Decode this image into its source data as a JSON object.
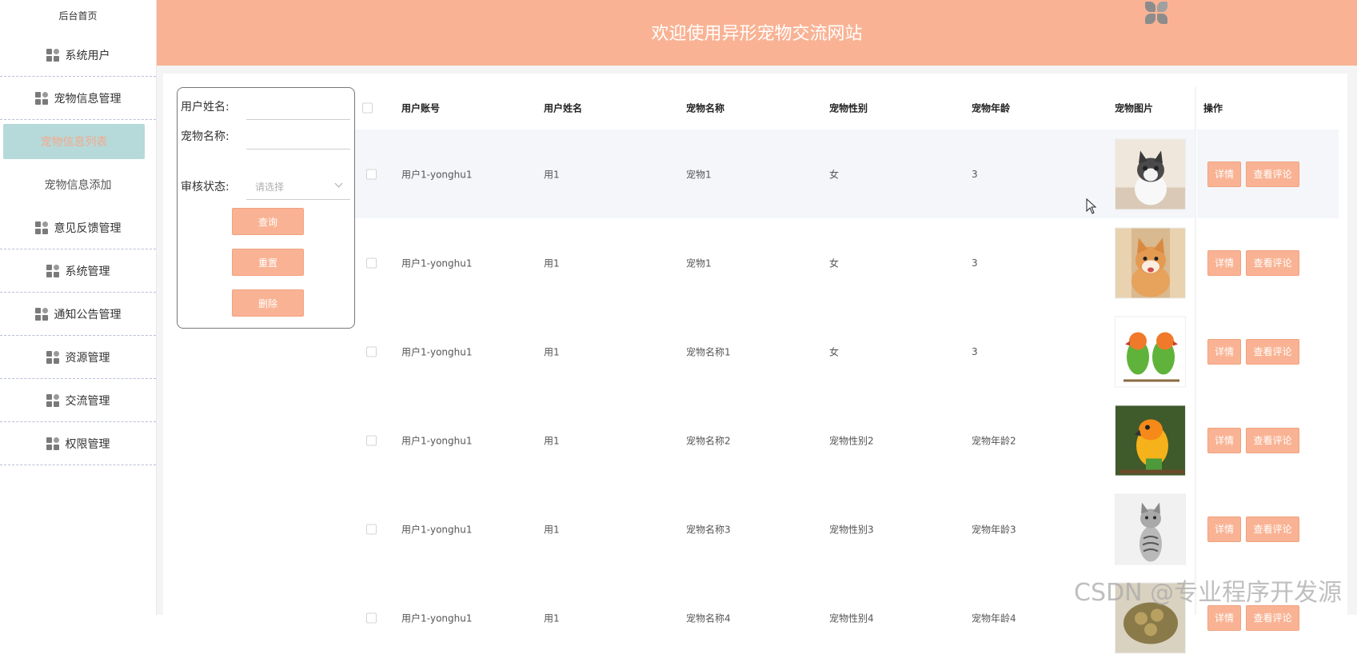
{
  "sidebar": {
    "home": "后台首页",
    "menus": [
      {
        "label": "系统用户"
      },
      {
        "label": "宠物信息管理",
        "subs": [
          {
            "label": "宠物信息列表",
            "active": true
          },
          {
            "label": "宠物信息添加"
          }
        ]
      },
      {
        "label": "意见反馈管理"
      },
      {
        "label": "系统管理"
      },
      {
        "label": "通知公告管理"
      },
      {
        "label": "资源管理"
      },
      {
        "label": "交流管理"
      },
      {
        "label": "权限管理"
      }
    ]
  },
  "header": {
    "title": "欢迎使用异形宠物交流网站",
    "logo_icon": "app-logo-icon"
  },
  "search": {
    "user_name_label": "用户姓名:",
    "pet_name_label": "宠物名称:",
    "status_label": "审核状态:",
    "status_placeholder": "请选择",
    "query_button": "查询",
    "reset_button": "重置",
    "delete_button": "删除"
  },
  "table": {
    "headers": [
      "用户账号",
      "用户姓名",
      "宠物名称",
      "宠物性别",
      "宠物年龄",
      "宠物图片",
      "操作"
    ],
    "rows": [
      {
        "account": "用户1-yonghu1",
        "name": "用1",
        "pet": "宠物1",
        "gender": "女",
        "age": "3",
        "image": "kitten",
        "hl": true
      },
      {
        "account": "用户1-yonghu1",
        "name": "用1",
        "pet": "宠物1",
        "gender": "女",
        "age": "3",
        "image": "shiba-puppy"
      },
      {
        "account": "用户1-yonghu1",
        "name": "用1",
        "pet": "宠物名称1",
        "gender": "女",
        "age": "3",
        "image": "lovebirds"
      },
      {
        "account": "用户1-yonghu1",
        "name": "用1",
        "pet": "宠物名称2",
        "gender": "宠物性别2",
        "age": "宠物年龄2",
        "image": "sun-conure"
      },
      {
        "account": "用户1-yonghu1",
        "name": "用1",
        "pet": "宠物名称3",
        "gender": "宠物性别3",
        "age": "宠物年龄3",
        "image": "tabby-cat"
      },
      {
        "account": "用户1-yonghu1",
        "name": "用1",
        "pet": "宠物名称4",
        "gender": "宠物性别4",
        "age": "宠物年龄4",
        "image": "tortoise"
      }
    ],
    "detail_button": "详情",
    "comments_button": "查看评论"
  },
  "watermark": "CSDN @专业程序开发源",
  "colors": {
    "accent": "#f9b394",
    "active_bg": "#b5dad9",
    "active_text": "#f6a88e"
  }
}
